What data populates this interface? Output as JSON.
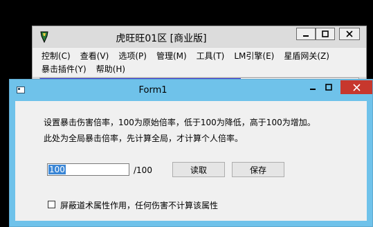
{
  "back_window": {
    "title": "虎旺旺01区 [商业版]",
    "menu_row1": [
      "控制(C)",
      "查看(V)",
      "选项(P)",
      "管理(M)",
      "工具(T)",
      "LM引擎(E)",
      "星盾网关(Z)"
    ],
    "menu_row2": [
      "暴击插件(Y)",
      "帮助(H)"
    ]
  },
  "form": {
    "title": "Form1",
    "description_line1": "设置暴击伤害倍率，100为原始倍率，低于100为降低，高于100为增加。",
    "description_line2": "此处为全局暴击倍率，先计算全局，才计算个人倍率。",
    "rate_value": "100",
    "rate_unit": "/100",
    "read_button": "读取",
    "save_button": "保存",
    "checkbox_label": "屏蔽道术属性作用，任何伤害不计算该属性",
    "checkbox_checked": false
  },
  "colors": {
    "form_title_bar": "#6fc2ea",
    "close_button": "#c7372d",
    "selection": "#3a86d6"
  }
}
